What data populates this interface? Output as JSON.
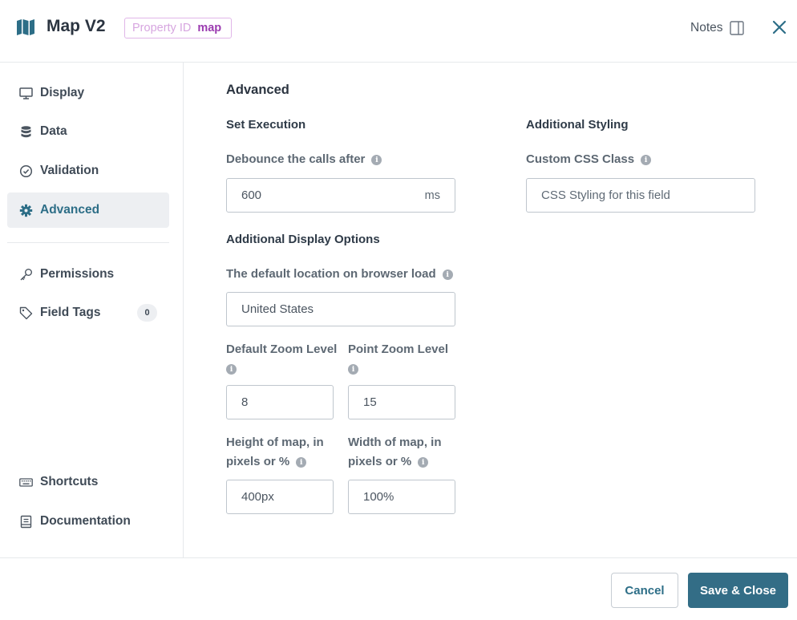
{
  "header": {
    "title": "Map V2",
    "property_id_label": "Property ID",
    "property_id_value": "map",
    "notes_label": "Notes"
  },
  "sidebar": {
    "items": [
      {
        "label": "Display",
        "icon": "monitor-icon"
      },
      {
        "label": "Data",
        "icon": "database-icon"
      },
      {
        "label": "Validation",
        "icon": "check-circle-icon"
      },
      {
        "label": "Advanced",
        "icon": "gear-icon",
        "active": true
      },
      {
        "label": "Permissions",
        "icon": "key-icon"
      },
      {
        "label": "Field Tags",
        "icon": "tag-icon",
        "count": "0"
      },
      {
        "label": "Shortcuts",
        "icon": "keyboard-icon"
      },
      {
        "label": "Documentation",
        "icon": "document-icon"
      }
    ]
  },
  "main": {
    "section_title": "Advanced",
    "set_execution": {
      "heading": "Set Execution",
      "debounce_label": "Debounce the calls after",
      "debounce_value": "600",
      "debounce_unit": "ms"
    },
    "additional_styling": {
      "heading": "Additional Styling",
      "css_class_label": "Custom CSS Class",
      "css_class_placeholder": "CSS Styling for this field"
    },
    "display_options": {
      "heading": "Additional Display Options",
      "default_location_label": "The default location on browser load",
      "default_location_value": "United States",
      "default_zoom_label": "Default Zoom Level",
      "default_zoom_value": "8",
      "point_zoom_label": "Point Zoom Level",
      "point_zoom_value": "15",
      "height_label_line1": "Height of map, in",
      "height_label_line2": "pixels or %",
      "height_value": "400px",
      "width_label_line1": "Width of map, in",
      "width_label_line2": "pixels or %",
      "width_value": "100%"
    }
  },
  "footer": {
    "cancel_label": "Cancel",
    "save_label": "Save & Close"
  },
  "colors": {
    "primary": "#336d86",
    "active_bg": "#edeff2",
    "property_badge": "#9b3bb0"
  }
}
